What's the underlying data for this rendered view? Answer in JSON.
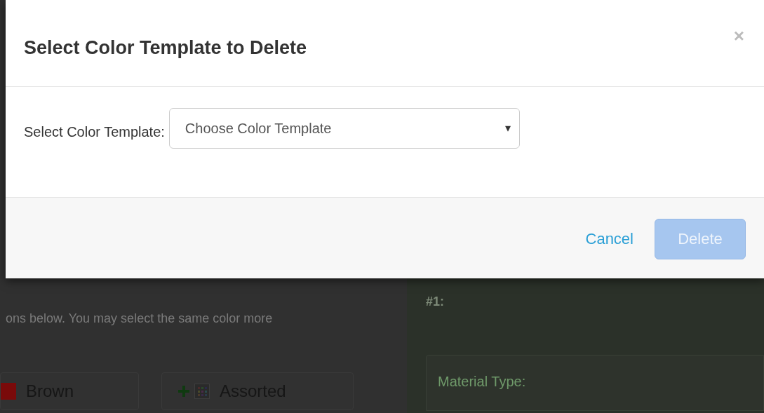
{
  "modal": {
    "title": "Select Color Template to Delete",
    "close": "×",
    "field_label": "Select Color Template:",
    "select": {
      "placeholder": "Choose Color Template",
      "caret": "▾"
    },
    "buttons": [
      {
        "label": "Cancel",
        "kind": "link",
        "disabled": false
      },
      {
        "label": "Delete",
        "kind": "primary",
        "disabled": true
      }
    ]
  },
  "background": {
    "instructions": "ons below. You may select the same color more",
    "colors": [
      {
        "label": "Brown",
        "kind": "swatch",
        "color": "#7a0a0a"
      },
      {
        "label": "Assorted",
        "kind": "assorted"
      }
    ],
    "panel_heading": "#1:",
    "material_label": "Material Type:"
  }
}
